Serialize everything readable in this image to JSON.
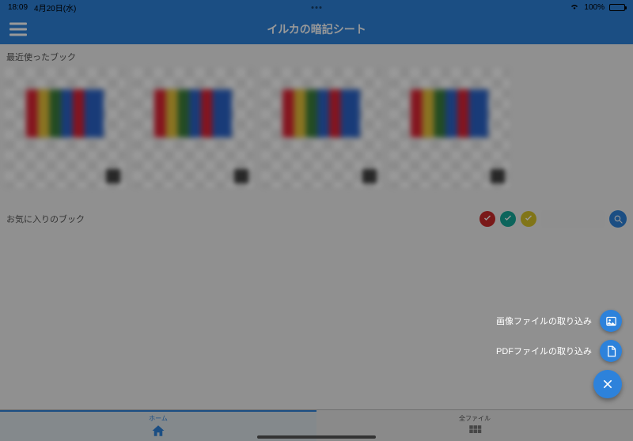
{
  "status": {
    "time": "18:09",
    "date": "4月20日(水)",
    "battery_pct": "100%"
  },
  "nav": {
    "title": "イルカの暗記シート"
  },
  "sections": {
    "recent_title": "最近使ったブック",
    "favorites_title": "お気に入りのブック"
  },
  "search": {
    "placeholder": ""
  },
  "fab": {
    "import_image_label": "画像ファイルの取り込み",
    "import_pdf_label": "PDFファイルの取り込み"
  },
  "tabs": {
    "home_label": "ホーム",
    "all_files_label": "全ファイル"
  }
}
